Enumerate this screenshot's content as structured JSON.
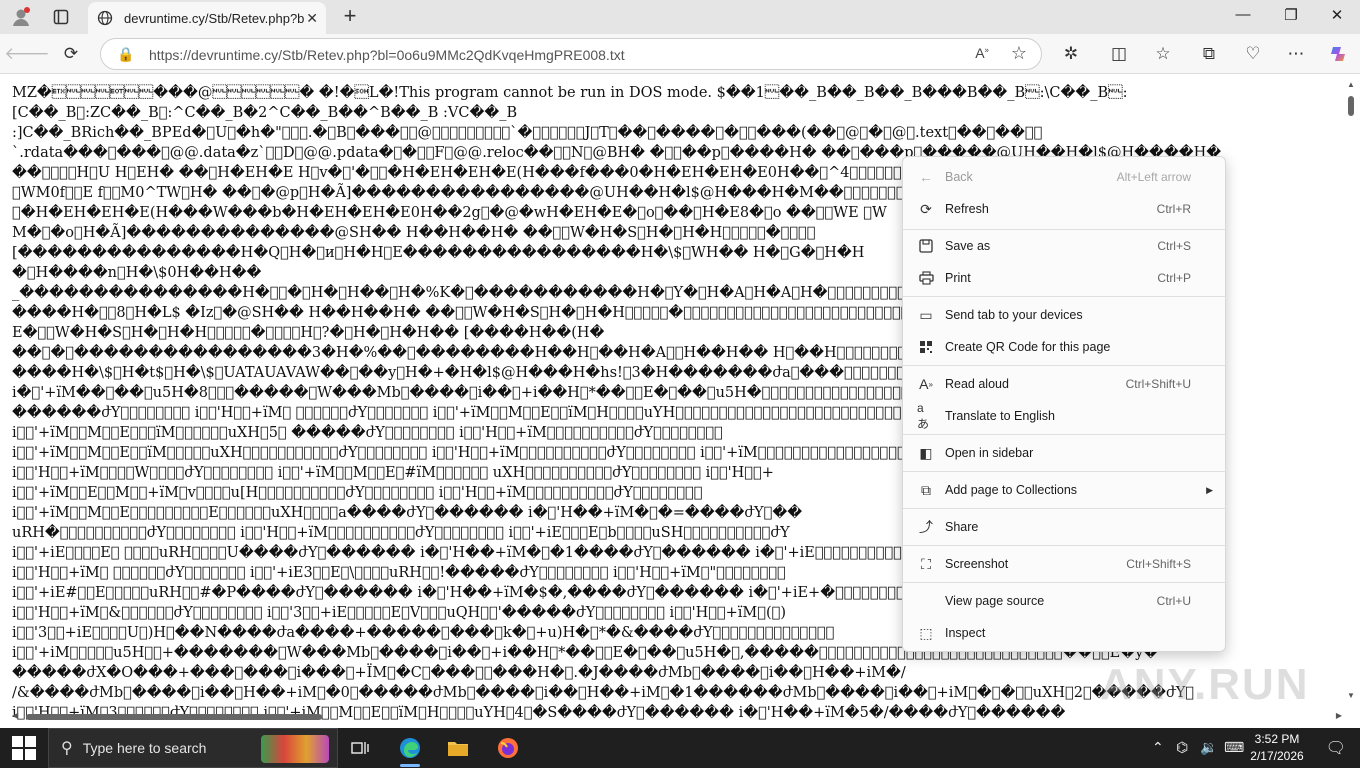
{
  "browser": {
    "tab_title": "devruntime.cy/Stb/Retev.php?bl=",
    "url": "https://devruntime.cy/Stb/Retev.php?bl=0o6u9MMc2QdKvqeHmgPRE008.txt"
  },
  "content": {
    "lines": [
      "MZ�\u0003\u0000\u0000\u0000\u0004\u0000\u0000���@\u0000\u0000\u0000\u0000\u0000\u0000� �!�\u0001L�!This program cannot be run in DOS mode. $��1\u0000��_B��_B��_B���B��_B\u0000:\\C��_B\u0000:",
      "[C��_B\u0000:ZC��_B\u0000:^C��_B�2^C��_B��^B��_B :VC��_B",
      ":]C��_BRich��_BPEd�\u0000U\u0000�h�\"\u0000\u0000\u0000.�\u0000B\u0000���\u0000\u0000@\u0000\u0000\u0000\u0000\u0000\u0000\u0000\u0000\u0000`�\u0000\u0000\u0000\u0000\u0000\u0000J\u0000T\u0000��\u0000����\u0000�\u0000\u0000���(��\u0000@\u0000�\u0000@\u0000.text\u0000��\u0000��\u0000\u0000",
      "`.rdata���\u0000���\u0000@@.data�z`\u0000\u0000D\u0000@@.pdata�\u0000�\u0000\u0000F\u0000@@.reloc��\u0000\u0000N\u0000@BH� �\u0000\u0000��p\u0000����H� ��\u0000���p\u0000�����@UH��H�l$@H����H�",
      "��\u0000\u0000\u0000\u0000H\u0000U H\u0000EH� ��\u0000H�EH�E H\u0000v�\u0000'�\u0000\u0000�H�EH�EH�E(H���f���0�H�EH�EH�E0H��\u0000^4\u0000\u0000\u0000\u0000\u0000\u0000\u0000\u0000\u0000\u0000\u0000\u0000\u0000\u0000WE",
      "\u0000WM0f\u0000\u0000E f\u0000\u0000M0^TW\u0000H� ��\u0000�@p\u0000H�Ã]����������������@UH��H�l$@H���H�M��\u0000\u0000\u0000\u0000\u0000\u0000\u0000\u0000\u0000\u0000\u0000\u0000\u0000\u0000\u0000\u0000\u0000�",
      "\u0000�H�EH�EH�E(H���W���b�H�EH�EH�E0H��2g\u0000�@�wH�EH�E�\u0000o\u0000��\u0000H�E8�\u0000o ��\u0000\u0000WE \u0000W",
      "M�\u0000�o\u0000H�Ã]��������������@SH�� H��H��H� ��\u0000\u0000W�H�S\u0000H�\u0000H�H\u0000\u0000\u0000\u0000\u0000�\u0000\u0000\u0000\u0000",
      "[���������������H�Q\u0000H�\u0000и\u0000H�H\u0000E����������������H�\\$\u0000WH�� H�\u0000G�\u0000H�H",
      "�\u0000H����n\u0000H�\\$0H��H��",
      "_���������������H�\u0000\u0000�\u0000H�\u0000H��\u0000H�%K�\u0000�����������H�\u0000Y�\u0000H�A\u0000H�A\u0000H�\u0000\u0000\u0000\u0000\u0000\u0000\u0000\u0000\u0000\u0000\u0000\u0000\u0000\u0000\u0000\u0000\u0000\u0000\u0000\u0000��H��HH\u0000",
      "����H�\u0000\u00008\u0000H�L$ �Iz\u0000�@SH�� H��H��H� ��\u0000\u0000W�H�S\u0000H�\u0000H�H\u0000\u0000\u0000\u0000\u0000�\u0000\u0000\u0000\u0000\u0000\u0000\u0000\u0000\u0000\u0000\u0000\u0000\u0000\u0000\u0000\u0000\u0000\u0000\u0000\u0000\u0000\u0000\u0000\u0000\u0000\u0000\u0000\u0000�",
      "E�\u0000\u0000W�H�S\u0000H�\u0000H�H\u0000\u0000\u0000\u0000\u0000�\u0000\u0000\u0000\u0000H\u0000?�\u0000H�\u0000H�H�� [����H��(H�",
      "��\u0000�\u0000����������������3�H�%��\u0000��������H��H\u0000��H�A\u0000\u0000H��H�� H\u0000��H\u0000\u0000\u0000\u0000\u0000\u0000\u0000\u0000\u0000\u0000\u0000\u0000\u0000\u0000\u0000\u0000\u0000\u0000\u0000\u0000\u0000\u0000\u0000\u0000\u0000\u0000\u0000\u0000\u0000\u0000\u0000\u0000",
      "����H�\\$\u0000H�t$\u0000H�\\$\u0000UATAUAVAW��\u0000��y\u0000H�+�H�l$@H���H�hs!\u00003�H�������ժa\u0000���\u0000\u0000\u0000\u0000\u0000\u0000\u0000\u0000\u0000\u0000\u0000\u0000\u0000\u0000\u0000\u0000\u0000\u0000\u0000\u0000\u0000\u0000\u0000\u0000\u0000\u0000ժY\u0000�����",
      "i�\u0000'+ïM��\u0000��\u0000u5H�8\u0000\u0000\u0000�����\u0000W���Mb\u0000����\u0000i��\u0000+i��H\u0000*��\u0000\u0000E�\u0000��\u0000u5H�\u0000\u0000\u0000\u0000\u0000\u0000\u0000\u0000\u0000\u0000\u0000\u0000\u0000\u0000\u0000\u0000\u0000\u0000\u0000\u0000\u0000\u0000\u0000\u0000\u0000\u0000*��\u0000\u0000E�y�",
      "������ժY\u0000\u0000\u0000\u0000\u0000\u0000\u0000\u0000 i\u0000\u0000'H\u0000\u0000+ïM\u0000 \u0000\u0000\u0000\u0000\u0000\u0000ժY\u0000\u0000\u0000\u0000\u0000\u0000\u0000 i\u0000\u0000'+ïM\u0000\u0000M\u0000\u0000E\u0000\u0000ïM\u0000H\u0000\u0000\u0000\u0000uYH\u0000\u0000\u0000\u0000\u0000\u0000\u0000\u0000\u0000\u0000\u0000\u0000\u0000\u0000\u0000\u0000\u0000\u0000\u0000\u0000\u0000\u0000\u0000\u0000\u0000\u0000\u0000\u0000\u0000\u0000Y\u0000\u0000\u0000\u0000\u0000\u0000\u0000\u0000\u0000",
      "i\u0000\u0000'+ïM\u0000\u0000M\u0000\u0000E\u0000\u0000\u0000ïM\u0000\u0000\u0000\u0000\u0000\u0000uXH\u00005\u0000 �����ժY\u0000\u0000\u0000\u0000\u0000\u0000\u0000\u0000 i\u0000\u0000'H\u0000\u0000+ïM\u0000\u0000\u0000\u0000\u0000\u0000\u0000\u0000\u0000\u0000ժY\u0000\u0000\u0000\u0000\u0000\u0000\u0000\u0000",
      "i\u0000\u0000'+ïM\u0000\u0000M\u0000\u0000E\u0000\u0000ïM\u0000\u0000\u0000\u0000\u0000uXH\u0000\u0000\u0000\u0000\u0000\u0000\u0000\u0000\u0000\u0000\u0000ժY\u0000\u0000\u0000\u0000\u0000\u0000\u0000\u0000 i\u0000\u0000'H\u0000\u0000+ïM\u0000\u0000\u0000\u0000\u0000\u0000\u0000\u0000\u0000\u0000ժY\u0000\u0000\u0000\u0000\u0000\u0000\u0000\u0000 i\u0000\u0000'+ïM\u0000\u0000\u0000\u0000\u0000\u0000\u0000\u0000\u0000\u0000\u0000\u0000\u0000\u0000\u0000\u0000\u0000\u0000\u0000\u0000\u0000\u0000",
      "i\u0000\u0000'H\u0000\u0000+ïM\u0000\u0000\u0000\u0000W\u0000\u0000\u0000\u0000ժY\u0000\u0000\u0000\u0000\u0000\u0000\u0000\u0000 i\u0000\u0000'+ïM\u0000\u0000M\u0000\u0000E\u0000#ïM\u0000\u0000\u0000\u0000\u0000\u0000 uXH\u0000\u0000\u0000\u0000\u0000\u0000\u0000\u0000\u0000\u0000ժY\u0000\u0000\u0000\u0000\u0000\u0000\u0000\u0000 i\u0000\u0000'H\u0000\u0000+",
      "i\u0000\u0000'+ïM\u0000\u0000E\u0000\u0000M\u0000\u0000+ïM\u0000v\u0000\u0000\u0000\u0000u[H\u0000\u0000\u0000\u0000\u0000\u0000\u0000\u0000\u0000\u0000ժY\u0000\u0000\u0000\u0000\u0000\u0000\u0000\u0000 i\u0000\u0000'H\u0000\u0000+ïM\u0000\u0000\u0000\u0000\u0000\u0000\u0000\u0000\u0000\u0000ժY\u0000\u0000\u0000\u0000\u0000\u0000\u0000\u0000",
      "i\u0000\u0000'+ïM\u0000\u0000M\u0000\u0000E\u0000\u0000\u0000\u0000\u0000\u0000\u0000\u0000\u0000E\u0000\u0000\u0000\u0000\u0000\u0000uXH\u0000\u0000\u0000\u0000a����ժY\u0000������ i�\u0000'H��+ïM�\u0000�=����ժY\u0000��",
      "uRH�\u0000\u0000\u0000\u0000\u0000\u0000\u0000\u0000\u0000\u0000ժY\u0000\u0000\u0000\u0000\u0000\u0000\u0000\u0000 i\u0000\u0000'H\u0000\u0000+ïM\u0000\u0000\u0000\u0000\u0000\u0000\u0000\u0000\u0000\u0000ժY\u0000\u0000\u0000\u0000\u0000\u0000\u0000\u0000 i\u0000\u0000'+iE\u0000\u0000\u0000E\u0000b\u0000\u0000\u0000\u0000uSH\u0000\u0000\u0000\u0000\u0000\u0000\u0000\u0000\u0000\u0000ժY",
      "i\u0000\u0000'+iE\u0000\u0000\u0000\u0000E\u0000 \u0000\u0000\u0000\u0000uRH\u0000\u0000\u0000\u0000U����ժY\u0000������ i�\u0000'H��+ïM�\u0000�1����ժY\u0000������ i�\u0000'+iE\u0000\u0000\u0000\u0000\u0000\u0000\u0000\u0000\u0000\u0000\u0000\u0000\u0000\u0000\u0000\u0000\u0000\u0000\u0000\u0000\u0000\u0000\u0000\u0000\u0000",
      "i\u0000\u0000'H\u0000\u0000+ïM\u0000 \u0000\u0000\u0000\u0000\u0000\u0000ժY\u0000\u0000\u0000\u0000\u0000\u0000\u0000 i\u0000\u0000'+iE3\u0000\u0000E\u0000\\\u0000\u0000\u0000\u0000uRH\u0000\u0000!�����ժY\u0000\u0000\u0000\u0000\u0000\u0000\u0000\u0000 i\u0000\u0000'H\u0000\u0000+ïM\u0000\"\u0000\u0000\u0000\u0000\u0000\u0000\u0000\u0000",
      "i\u0000\u0000'+iE#\u0000\u0000E\u0000\u0000\u0000\u0000\u0000uRH\u0000\u0000#�P����ժY\u0000������ i�\u0000'H��+ïM�$�,����ժY\u0000������ i�\u0000'+iE+�\u0000\u0000\u0000\u0000\u0000\u0000\u0000\u0000\u0000\u0000\u0000\u0000\u0000\u0000\u0000\u0000\u0000\u0000\u0000\u0000\u0000\u0000",
      "i\u0000\u0000'H\u0000\u0000+ïM\u0000&\u0000\u0000\u0000\u0000\u0000\u0000ժY\u0000\u0000\u0000\u0000\u0000\u0000\u0000\u0000 i\u0000\u0000'3\u0000\u0000+iE\u0000\u0000\u0000\u0000\u0000E\u0000V\u0000\u0000\u0000uQH\u0000\u0000'�����ժY\u0000\u0000\u0000\u0000\u0000\u0000\u0000\u0000 i\u0000\u0000'H\u0000\u0000+ïM\u0000(\u0000)",
      "i\u0000\u0000'3\u0000\u0000+iE\u0000\u0000\u0000\u0000U\u0000)H\u0000��N����ժa����+�����\u0000���\u0000k�\u0000+u)H�\u0000*�&����ժY\u0000\u0000\u0000\u0000\u0000\u0000\u0000\u0000\u0000\u0000\u0000\u0000\u0000\u0000",
      "i\u0000\u0000'+iM\u0000\u0000\u0000\u0000\u0000u5H\u0000\u0000+�������\u0000W���Mb\u0000����\u0000i��\u0000+i��H\u0000*��\u0000\u0000E�\u0000��\u0000u5H�\u0000,�����\u0000\u0000\u0000\u0000\u0000\u0000\u0000\u0000\u0000\u0000\u0000\u0000\u0000\u0000\u0000\u0000\u0000\u0000\u0000\u0000\u0000\u0000\u0000\u0000\u0000\u0000\u0000\u0000��\u0000\u0000E�y�",
      "�����ժX�O���+���\u0000���\u0000i���\u0000+ÏM\u0000�C\u0000���\u0000\u0000���H�\u0000.�J����ժMb\u0000����\u0000i��\u0000H��+iM�/",
      "/&����ժMb\u0000����\u0000i��\u0000H��+iM\u0000�0\u0000�����ժMb\u0000����\u0000i��\u0000H��+iM\u0000�1������ժMb\u0000����\u0000i��\u0000+iM\u0000�\u0000�\u0000\u0000uXH\u00002\u0000�����ժY\u0000",
      "i\u0000\u0000'H\u0000\u0000+ïM\u00003\u0000\u0000\u0000\u0000\u0000\u0000ժY\u0000\u0000\u0000\u0000\u0000\u0000\u0000\u0000 i\u0000\u0000'+iM\u0000\u0000M\u0000\u0000E\u0000\u0000ïM\u0000H\u0000\u0000\u0000\u0000uYH\u00004\u0000�S����ժY\u0000������ i�\u0000'H��+ïM�5�/����ժY\u0000������"
    ]
  },
  "context_menu": {
    "items": [
      {
        "label": "Back",
        "shortcut": "Alt+Left arrow",
        "icon": "arrow-left-icon",
        "disabled": true
      },
      {
        "label": "Refresh",
        "shortcut": "Ctrl+R",
        "icon": "refresh-icon"
      },
      {
        "label": "Save as",
        "shortcut": "Ctrl+S",
        "icon": "save-icon"
      },
      {
        "label": "Print",
        "shortcut": "Ctrl+P",
        "icon": "print-icon"
      },
      {
        "label": "Send tab to your devices",
        "shortcut": "",
        "icon": "send-tab-icon"
      },
      {
        "label": "Create QR Code for this page",
        "shortcut": "",
        "icon": "qr-code-icon"
      },
      {
        "label": "Read aloud",
        "shortcut": "Ctrl+Shift+U",
        "icon": "read-aloud-icon"
      },
      {
        "label": "Translate to English",
        "shortcut": "",
        "icon": "translate-icon"
      },
      {
        "label": "Open in sidebar",
        "shortcut": "",
        "icon": "sidebar-icon"
      },
      {
        "label": "Add page to Collections",
        "shortcut": "",
        "icon": "collections-icon",
        "submenu": true
      },
      {
        "label": "Share",
        "shortcut": "",
        "icon": "share-icon"
      },
      {
        "label": "Screenshot",
        "shortcut": "Ctrl+Shift+S",
        "icon": "screenshot-icon"
      },
      {
        "label": "View page source",
        "shortcut": "Ctrl+U",
        "icon": ""
      },
      {
        "label": "Inspect",
        "shortcut": "",
        "icon": "inspect-icon"
      }
    ]
  },
  "taskbar": {
    "search_placeholder": "Type here to search",
    "time": "3:52 PM",
    "date": "2/17/2026"
  },
  "watermark": "ANY.RUN",
  "colors": {
    "tabbar_bg": "#e5e5e5",
    "taskbar_bg": "#1f1f1f",
    "edge_blue": "#1f8fd8",
    "accent": "#7ab8ff"
  }
}
